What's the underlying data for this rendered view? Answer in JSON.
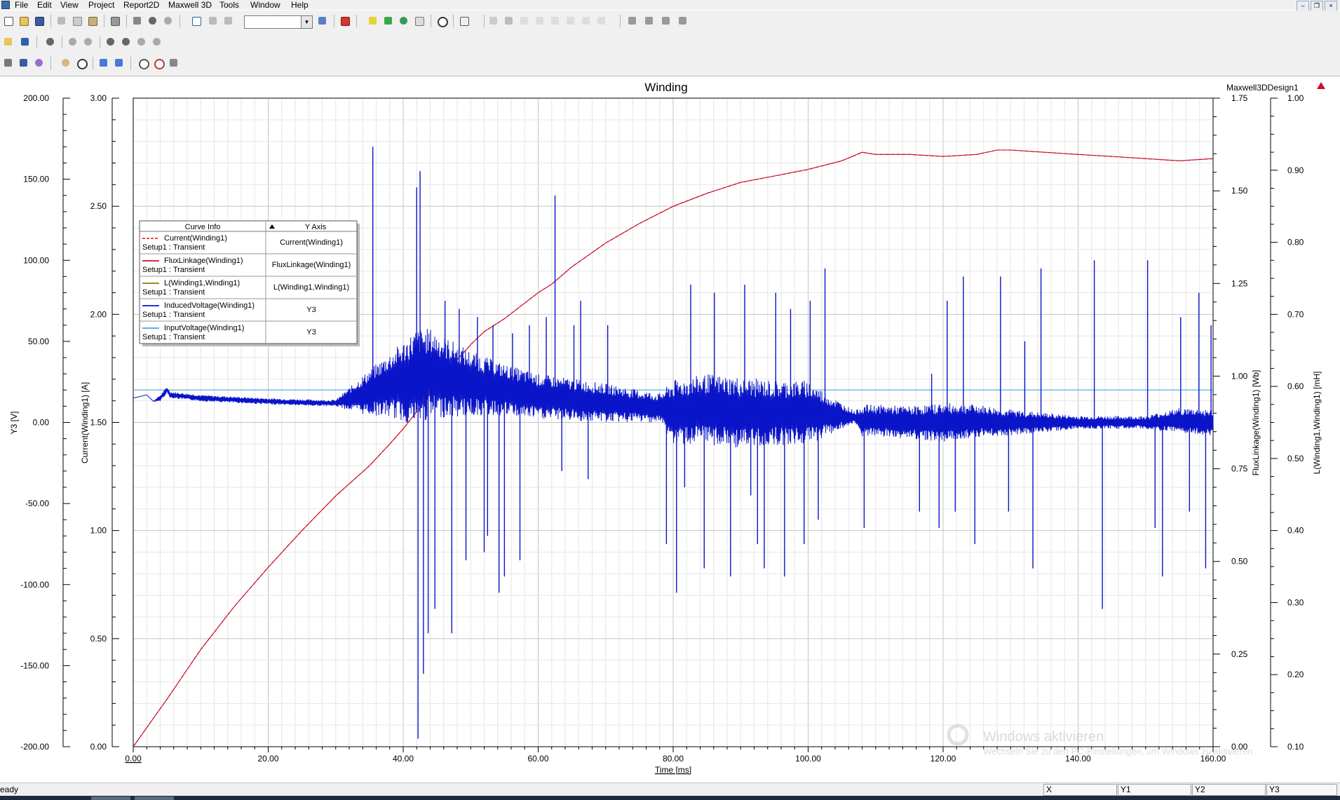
{
  "menu": {
    "items": [
      "File",
      "Edit",
      "View",
      "Project",
      "Report2D",
      "Maxwell 3D",
      "Tools",
      "Window",
      "Help"
    ]
  },
  "window_controls": [
    "minimize-icon",
    "restore-icon",
    "close-icon"
  ],
  "chart_data": {
    "type": "line",
    "title": "Winding",
    "design_label": "Maxwell3DDesign1",
    "xlabel": "Time [ms]",
    "xlim": [
      0,
      160
    ],
    "x_ticks": [
      "0.00",
      "20.00",
      "40.00",
      "60.00",
      "80.00",
      "100.00",
      "120.00",
      "140.00",
      "160.00"
    ],
    "grid": true,
    "axes": {
      "y3": {
        "label": "Y3 [V]",
        "range": [
          -200,
          200
        ],
        "ticks": [
          "200.00",
          "150.00",
          "100.00",
          "50.00",
          "0.00",
          "-50.00",
          "-100.00",
          "-150.00",
          "-200.00"
        ]
      },
      "current": {
        "label": "Current(Winding1) [A]",
        "range": [
          0,
          3
        ],
        "ticks": [
          "3.00",
          "2.50",
          "2.00",
          "1.50",
          "1.00",
          "0.50",
          "0.00"
        ]
      },
      "flux": {
        "label": "FluxLinkage(Winding1) [Wb]",
        "range": [
          0,
          1.75
        ],
        "ticks": [
          "1.75",
          "1.50",
          "1.25",
          "1.00",
          "0.75",
          "0.50",
          "0.25",
          "0.00"
        ]
      },
      "inductance": {
        "label": "L(Winding1,Winding1) [mH]",
        "range": [
          0.1,
          1.0
        ],
        "ticks": [
          "1.00",
          "0.90",
          "0.80",
          "0.70",
          "0.60",
          "0.50",
          "0.40",
          "0.30",
          "0.20",
          "0.10"
        ]
      }
    },
    "legend": {
      "placement": "top-left",
      "headers": [
        "Curve Info",
        "Y Axis"
      ],
      "entries": [
        {
          "name": "Current(Winding1)",
          "setup": "Setup1 : Transient",
          "axis": "Current(Winding1)",
          "color": "#e8332e",
          "dash": "dashed"
        },
        {
          "name": "FluxLinkage(Winding1)",
          "setup": "Setup1 : Transient",
          "axis": "FluxLinkage(Winding1)",
          "color": "#c8102e",
          "dash": "solid"
        },
        {
          "name": "L(Winding1,Winding1)",
          "setup": "Setup1 : Transient",
          "axis": "L(Winding1,Winding1)",
          "color": "#8a7a00",
          "dash": "solid"
        },
        {
          "name": "InducedVoltage(Winding1)",
          "setup": "Setup1 : Transient",
          "axis": "Y3",
          "color": "#0a14c8",
          "dash": "solid"
        },
        {
          "name": "InputVoltage(Winding1)",
          "setup": "Setup1 : Transient",
          "axis": "Y3",
          "color": "#4ea6dc",
          "dash": "solid"
        }
      ]
    },
    "series": [
      {
        "name": "Current(Winding1)",
        "axis": "current",
        "color": "#e8332e",
        "x": [
          0,
          5,
          10,
          15,
          20,
          25,
          30,
          35,
          38,
          40,
          42,
          44,
          46,
          48,
          50,
          52,
          55,
          60,
          62,
          65,
          70,
          75,
          80,
          85,
          90,
          95,
          100,
          105,
          108,
          110,
          115,
          120,
          125,
          128,
          130,
          135,
          140,
          145,
          150,
          155,
          160
        ],
        "y": [
          0.0,
          0.22,
          0.45,
          0.65,
          0.83,
          1.0,
          1.16,
          1.3,
          1.4,
          1.47,
          1.55,
          1.63,
          1.71,
          1.79,
          1.86,
          1.92,
          1.98,
          2.1,
          2.14,
          2.22,
          2.33,
          2.42,
          2.5,
          2.56,
          2.61,
          2.64,
          2.67,
          2.71,
          2.75,
          2.74,
          2.74,
          2.73,
          2.74,
          2.76,
          2.76,
          2.75,
          2.74,
          2.73,
          2.72,
          2.71,
          2.72
        ]
      },
      {
        "name": "FluxLinkage(Winding1)",
        "axis": "flux",
        "color": "#c8102e",
        "x": [
          0,
          5,
          10,
          15,
          20,
          25,
          30,
          35,
          38,
          40,
          42,
          44,
          46,
          48,
          50,
          52,
          55,
          60,
          62,
          65,
          70,
          75,
          80,
          85,
          90,
          95,
          100,
          105,
          108,
          110,
          115,
          120,
          125,
          128,
          130,
          135,
          140,
          145,
          150,
          155,
          160
        ],
        "y": [
          0.0,
          0.128,
          0.262,
          0.379,
          0.484,
          0.583,
          0.677,
          0.758,
          0.817,
          0.858,
          0.904,
          0.951,
          0.997,
          1.044,
          1.085,
          1.12,
          1.155,
          1.225,
          1.248,
          1.295,
          1.359,
          1.412,
          1.458,
          1.493,
          1.523,
          1.54,
          1.558,
          1.581,
          1.604,
          1.598,
          1.598,
          1.593,
          1.598,
          1.61,
          1.61,
          1.604,
          1.598,
          1.593,
          1.587,
          1.581,
          1.587
        ]
      },
      {
        "name": "InputVoltage(Winding1)",
        "axis": "y3",
        "color": "#4ea6dc",
        "x": [
          0,
          160
        ],
        "y": [
          20,
          20
        ]
      },
      {
        "name": "InducedVoltage(Winding1)",
        "axis": "y3",
        "color": "#0a14c8",
        "envelope": {
          "x": [
            0,
            2,
            3,
            4,
            5,
            5.5,
            10,
            20,
            28,
            30,
            34,
            38,
            40,
            42,
            44,
            46,
            48,
            50,
            55,
            60,
            65,
            70,
            75,
            78,
            80,
            85,
            90,
            95,
            100,
            105,
            107,
            108,
            110,
            115,
            120,
            125,
            130,
            135,
            140,
            145,
            150,
            155,
            160
          ],
          "mid": [
            15,
            17,
            13,
            15,
            20,
            17,
            15,
            13,
            12,
            12,
            17,
            23,
            25,
            28,
            30,
            28,
            26,
            24,
            20,
            16,
            14,
            12,
            10,
            9,
            6,
            8,
            6,
            6,
            6,
            4,
            3,
            1,
            1,
            0,
            0,
            1,
            0,
            0,
            0,
            0,
            0,
            1,
            0
          ],
          "half": [
            0,
            0,
            0,
            2,
            2,
            2,
            2,
            2,
            2,
            2,
            12,
            20,
            25,
            30,
            28,
            25,
            23,
            20,
            16,
            14,
            13,
            12,
            10,
            9,
            20,
            22,
            22,
            20,
            20,
            8,
            4,
            10,
            10,
            10,
            12,
            10,
            8,
            6,
            4,
            4,
            4,
            8,
            8
          ]
        },
        "spikes_x": [
          35.5,
          42,
          42.2,
          42.5,
          43,
          43.7,
          44.7,
          46.2,
          47.2,
          48.3,
          49.3,
          51,
          52,
          52.5,
          53.3,
          54.2,
          55,
          56.2,
          57.3,
          58.7,
          61.2,
          62.5,
          63.5,
          65.3,
          66.3,
          67.4,
          70.3,
          79,
          80.5,
          81.7,
          82.6,
          84.6,
          86.1,
          88.5,
          90.6,
          91.5,
          92.5,
          93.5,
          95.2,
          96.5,
          97.4,
          99.4,
          100.3,
          101.5,
          102.5,
          108.3,
          116.5,
          118.3,
          119.4,
          120.6,
          121.8,
          123,
          124.7,
          128.5,
          129.7,
          132.1,
          133.3,
          134.5,
          142.4,
          143.6,
          150.3,
          151.4,
          152.5,
          155.2,
          156.5,
          157.9,
          158.9,
          159.7
        ],
        "spikes_y": [
          170,
          145,
          -195,
          155,
          -155,
          -130,
          -115,
          75,
          -130,
          70,
          -85,
          65,
          -80,
          -70,
          60,
          -105,
          -95,
          55,
          -85,
          60,
          65,
          140,
          -30,
          60,
          75,
          -35,
          60,
          -75,
          -105,
          -40,
          85,
          -90,
          80,
          -95,
          85,
          -45,
          -75,
          -90,
          80,
          -95,
          70,
          -75,
          75,
          -60,
          95,
          -65,
          -55,
          30,
          -65,
          75,
          -55,
          90,
          -75,
          90,
          -55,
          50,
          -90,
          95,
          100,
          -115,
          100,
          -65,
          -95,
          65,
          -55,
          80,
          -90,
          60
        ]
      }
    ]
  },
  "watermark": {
    "line1": "Windows aktivieren",
    "line2": "Wechseln Sie zu den PC-Einstellungen, um Windows zu aktivieren."
  },
  "status": {
    "text": "eady",
    "cells": [
      "X",
      "Y1",
      "Y2",
      "Y3"
    ]
  }
}
